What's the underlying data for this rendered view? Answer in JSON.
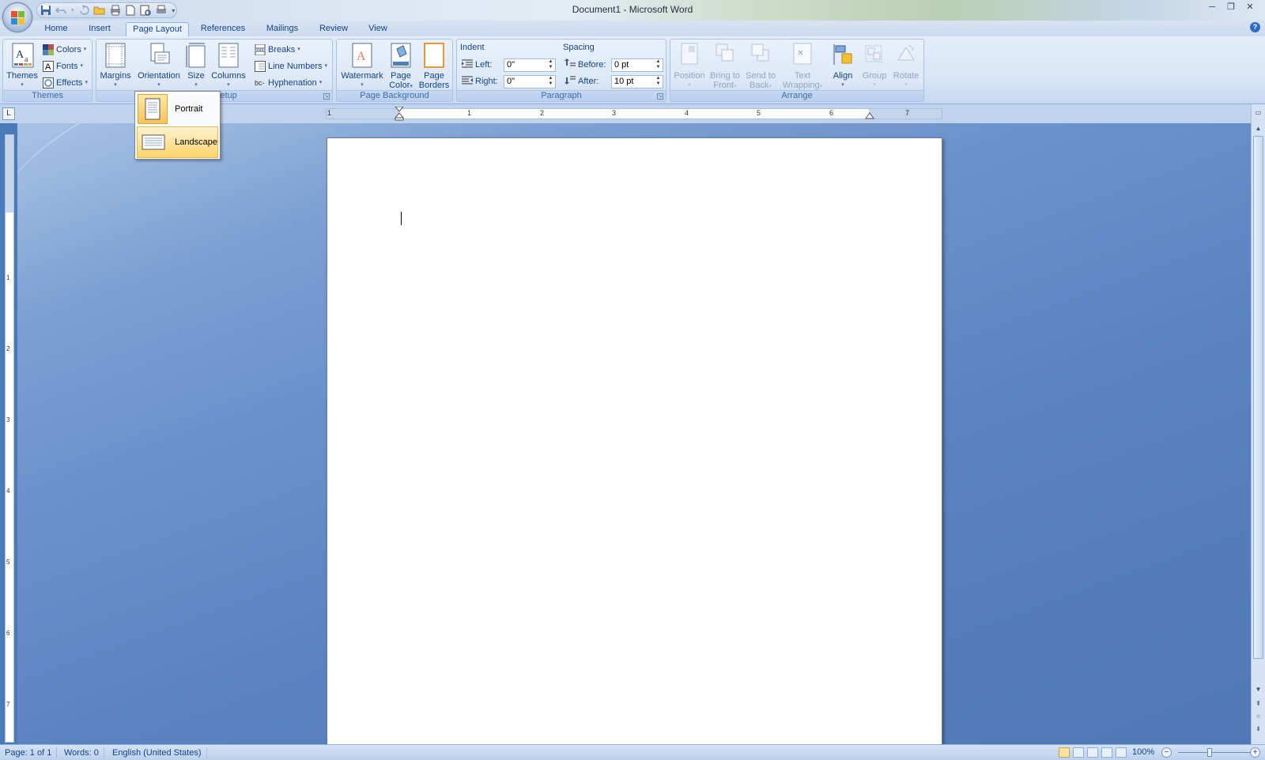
{
  "window": {
    "title": "Document1 - Microsoft Word"
  },
  "tabs": [
    {
      "label": "Home"
    },
    {
      "label": "Insert"
    },
    {
      "label": "Page Layout"
    },
    {
      "label": "References"
    },
    {
      "label": "Mailings"
    },
    {
      "label": "Review"
    },
    {
      "label": "View"
    }
  ],
  "ribbon": {
    "themes": {
      "group_label": "Themes",
      "themes_label": "Themes",
      "colors_label": "Colors",
      "fonts_label": "Fonts",
      "effects_label": "Effects"
    },
    "page_setup": {
      "group_label": "Page Setup",
      "margins_label": "Margins",
      "orientation_label": "Orientation",
      "size_label": "Size",
      "columns_label": "Columns",
      "breaks_label": "Breaks",
      "line_numbers_label": "Line Numbers",
      "hyphenation_label": "Hyphenation"
    },
    "page_background": {
      "group_label": "Page Background",
      "watermark_label": "Watermark",
      "page_color_label_1": "Page",
      "page_color_label_2": "Color",
      "page_borders_label_1": "Page",
      "page_borders_label_2": "Borders"
    },
    "paragraph": {
      "group_label": "Paragraph",
      "indent_title": "Indent",
      "left_label": "Left:",
      "left_value": "0\"",
      "right_label": "Right:",
      "right_value": "0\"",
      "spacing_title": "Spacing",
      "before_label": "Before:",
      "before_value": "0 pt",
      "after_label": "After:",
      "after_value": "10 pt"
    },
    "arrange": {
      "group_label": "Arrange",
      "position_label": "Position",
      "bring_front_1": "Bring to",
      "bring_front_2": "Front",
      "send_back_1": "Send to",
      "send_back_2": "Back",
      "text_wrap_1": "Text",
      "text_wrap_2": "Wrapping",
      "align_label": "Align",
      "group_label_btn": "Group",
      "rotate_label": "Rotate"
    }
  },
  "orientation_menu": {
    "portrait_label": "Portrait",
    "landscape_label": "Landscape",
    "selected": "Portrait",
    "hovered": "Landscape"
  },
  "ruler": {
    "h_numbers": [
      "1",
      "1",
      "2",
      "3",
      "4",
      "5",
      "6",
      "7"
    ],
    "v_numbers": [
      "1",
      "2",
      "3",
      "4",
      "5",
      "6",
      "7"
    ]
  },
  "status": {
    "page": "Page: 1 of 1",
    "words": "Words: 0",
    "language": "English (United States)",
    "zoom": "100%"
  },
  "colors": {
    "accent": "#15428b",
    "doc_bg": "#5a83c0",
    "hover": "#ffd36b"
  }
}
